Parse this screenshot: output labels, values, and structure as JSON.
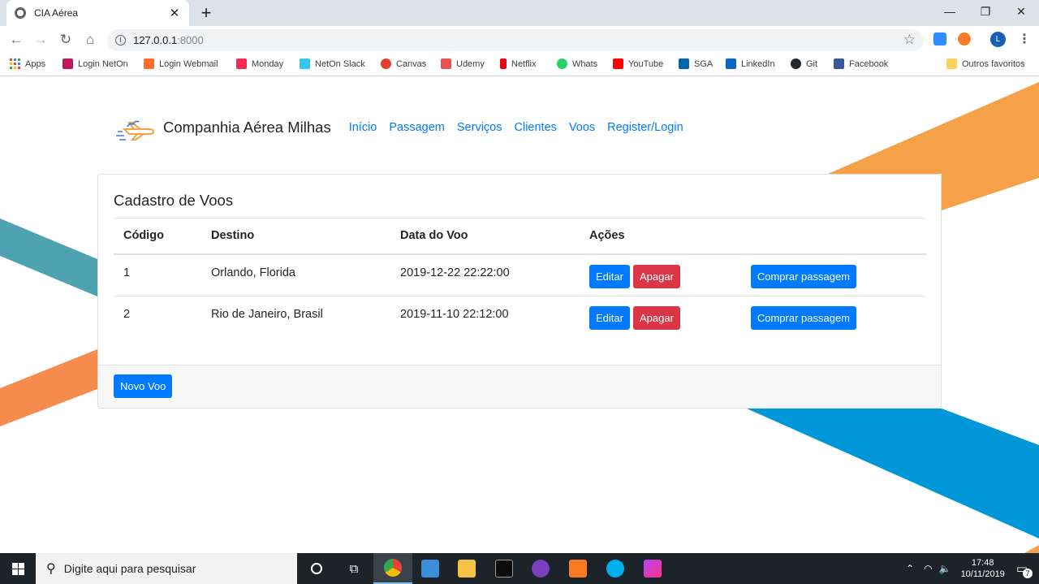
{
  "browser": {
    "tab_title": "CIA Aérea",
    "tab_close": "✕",
    "new_tab": "+",
    "url_host": "127.0.0.1",
    "url_port": ":8000",
    "window_controls": [
      "—",
      "❐",
      "✕"
    ],
    "profile_initial": "L",
    "bookmarks": [
      {
        "label": "Apps",
        "icon": "apps-icon",
        "color": "#4285f4"
      },
      {
        "label": "Login NetOn",
        "icon": "neton-icon",
        "color": "#c2185b"
      },
      {
        "label": "Login Webmail",
        "icon": "cpanel-icon",
        "color": "#ff6c2c"
      },
      {
        "label": "Monday",
        "icon": "monday-icon",
        "color": "#f62b54"
      },
      {
        "label": "NetOn Slack",
        "icon": "slack-icon",
        "color": "#36c5f0"
      },
      {
        "label": "Canvas",
        "icon": "canvas-icon",
        "color": "#e13f2b"
      },
      {
        "label": "Udemy",
        "icon": "udemy-icon",
        "color": "#ec5252"
      },
      {
        "label": "Netflix",
        "icon": "netflix-icon",
        "color": "#e50914"
      },
      {
        "label": "Whats",
        "icon": "whatsapp-icon",
        "color": "#25d366"
      },
      {
        "label": "YouTube",
        "icon": "youtube-icon",
        "color": "#ff0000"
      },
      {
        "label": "SGA",
        "icon": "sga-icon",
        "color": "#0066aa"
      },
      {
        "label": "LinkedIn",
        "icon": "linkedin-icon",
        "color": "#0a66c2"
      },
      {
        "label": "Git",
        "icon": "github-icon",
        "color": "#24292e"
      },
      {
        "label": "Facebook",
        "icon": "facebook-icon",
        "color": "#3b5998"
      }
    ],
    "other_bookmarks": "Outros favoritos"
  },
  "site": {
    "brand": "Companhia Aérea Milhas",
    "nav": [
      "Início",
      "Passagem",
      "Serviços",
      "Clientes",
      "Voos",
      "Register/Login"
    ]
  },
  "card": {
    "title": "Cadastro de Voos",
    "columns": [
      "Código",
      "Destino",
      "Data do Voo",
      "Ações"
    ],
    "rows": [
      {
        "codigo": "1",
        "destino": "Orlando, Florida",
        "data": "2019-12-22 22:22:00"
      },
      {
        "codigo": "2",
        "destino": "Rio de Janeiro, Brasil",
        "data": "2019-11-10 22:12:00"
      }
    ],
    "edit_label": "Editar",
    "delete_label": "Apagar",
    "buy_label": "Comprar passagem",
    "new_label": "Novo Voo"
  },
  "taskbar": {
    "search_placeholder": "Digite aqui para pesquisar",
    "time": "17:48",
    "date": "10/11/2019",
    "notifications": "7"
  },
  "colors": {
    "primary": "#007bff",
    "danger": "#dc3545",
    "orange": "#f5a14a",
    "teal": "#4fa3b0",
    "blue": "#0097d8"
  }
}
